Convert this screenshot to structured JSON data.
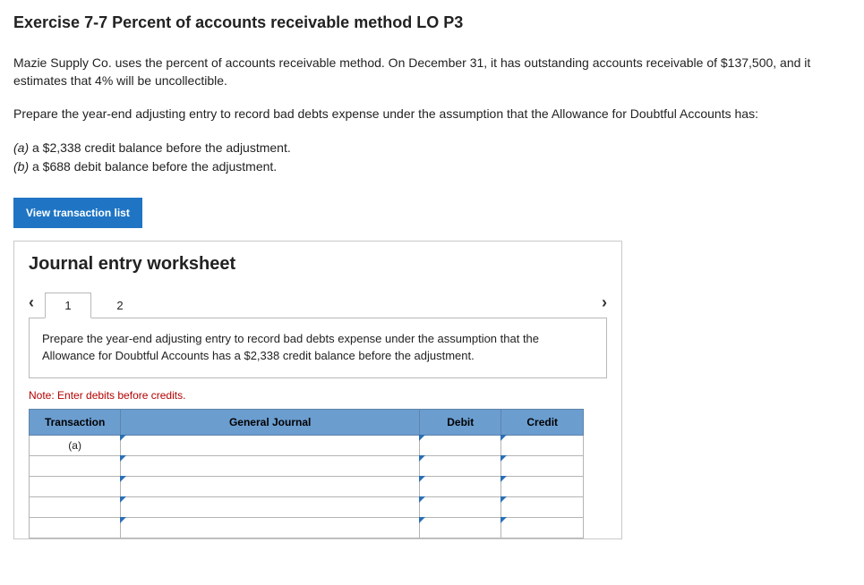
{
  "title": "Exercise 7-7 Percent of accounts receivable method LO P3",
  "para1": "Mazie Supply Co. uses the percent of accounts receivable method. On December 31, it has outstanding accounts receivable of $137,500, and it estimates that 4% will be uncollectible.",
  "para2": "Prepare the year-end adjusting entry to record bad debts expense under the assumption that the Allowance for Doubtful Accounts has:",
  "opt_a_prefix": "(a) ",
  "opt_a_text": "a $2,338 credit balance before the adjustment.",
  "opt_b_prefix": "(b) ",
  "opt_b_text": "a $688 debit balance before the adjustment.",
  "view_btn": "View transaction list",
  "worksheet": {
    "heading": "Journal entry worksheet",
    "tabs": {
      "t1": "1",
      "t2": "2"
    },
    "instruction": "Prepare the year-end adjusting entry to record bad debts expense under the assumption that the Allowance for Doubtful Accounts has a $2,338 credit balance before the adjustment.",
    "note": "Note: Enter debits before credits.",
    "headers": {
      "transaction": "Transaction",
      "gj": "General Journal",
      "debit": "Debit",
      "credit": "Credit"
    },
    "rows": {
      "r0_trans": "(a)"
    }
  }
}
